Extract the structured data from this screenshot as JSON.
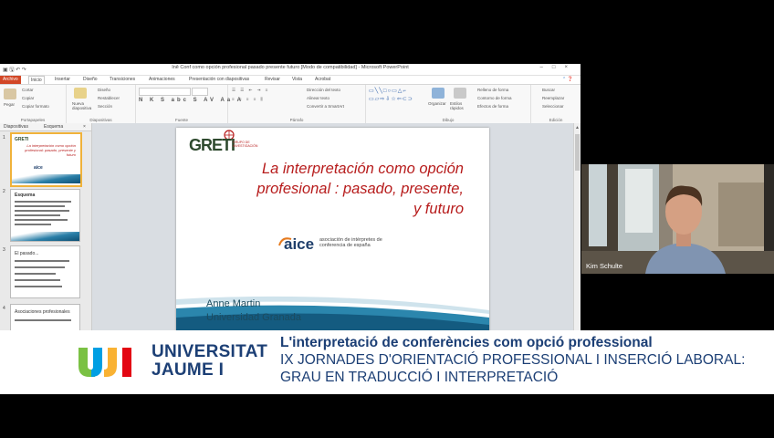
{
  "window": {
    "title": "Inê Conf como opción profesional pasado presente futuro [Modo de compatibilidad] - Microsoft PowerPoint",
    "window_controls": [
      "–",
      "□",
      "×"
    ]
  },
  "ribbon_tabs": [
    "Archivo",
    "Inicio",
    "Insertar",
    "Diseño",
    "Transiciones",
    "Animaciones",
    "Presentación con diapositivas",
    "Revisar",
    "Vista",
    "Acrobat"
  ],
  "ribbon": {
    "portapapeles": {
      "label": "Portapapeles",
      "paste": "Pegar",
      "cut": "Cortar",
      "copy": "Copiar",
      "format": "Copiar formato"
    },
    "diapositivas": {
      "label": "Diapositivas",
      "new_slide": "Nueva diapositiva",
      "layout": "Diseño",
      "reset": "Restablecer",
      "section": "Sección"
    },
    "fuente": {
      "label": "Fuente"
    },
    "parrafo": {
      "label": "Párrafo",
      "text_dir": "Dirección del texto",
      "align": "Alinear texto",
      "smartart": "Convertir a SmartArt"
    },
    "dibujo": {
      "label": "Dibujo",
      "arrange": "Organizar",
      "quick_styles": "Estilos rápidos",
      "fill": "Relleno de forma",
      "outline": "Contorno de forma",
      "effects": "Efectos de forma"
    },
    "edicion": {
      "label": "Edición",
      "find": "Buscar",
      "replace": "Reemplazar",
      "select": "Seleccionar"
    }
  },
  "left_pane": {
    "tabs": [
      "Diapositivas",
      "Esquema"
    ],
    "thumbnails": [
      {
        "num": "1",
        "title": "La interpretación como opción profesional: pasado, presente y futuro"
      },
      {
        "num": "2",
        "title": "Esquema"
      },
      {
        "num": "3",
        "title": "El pasado..."
      },
      {
        "num": "4",
        "title": "Asociaciones profesionales"
      }
    ]
  },
  "slide": {
    "logo_text": "GRETI",
    "logo_sub": "GRUPO DE INVESTIGACIÓN",
    "title_line1": "La interpretación como opción",
    "title_line2": "profesional : pasado, presente,",
    "title_line3": "y futuro",
    "aice_logo": "aice",
    "aice_desc": "asociación de intérpretes de conferencia de españa",
    "author": "Anne Martin",
    "university": "Universidad Granada"
  },
  "webcam": {
    "participant_name": "Kim Schulte"
  },
  "banner": {
    "university_line1": "UNIVERSITAT",
    "university_line2": "JAUME I",
    "line1": "L'interpretació de conferències com opció professional",
    "line2": "IX JORNADES D'ORIENTACIÓ PROFESSIONAL I INSERCIÓ LABORAL:",
    "line3": "GRAU EN TRADUCCIÓ I INTERPRETACIÓ"
  },
  "colors": {
    "ppt_accent": "#d24726",
    "slide_title": "#b71c1c",
    "banner_text": "#1c3f75",
    "uji_green": "#7ac143",
    "uji_blue": "#009fe3",
    "uji_red": "#e30613"
  }
}
